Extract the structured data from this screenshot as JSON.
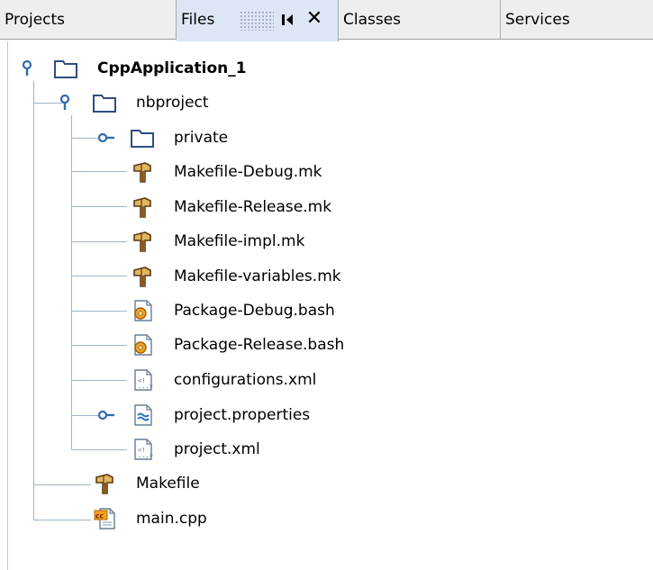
{
  "tabs": [
    {
      "label": "Projects"
    },
    {
      "label": "Files",
      "active": true
    },
    {
      "label": "Classes"
    },
    {
      "label": "Services"
    }
  ],
  "tab_icons": {
    "minimize": "minimize-icon",
    "close": "close-icon",
    "grip": "drag-grip-icon"
  },
  "tree": {
    "root": {
      "label": "CppApplication_1",
      "icon": "folder-icon",
      "expanded": true
    },
    "nbproject": {
      "label": "nbproject",
      "icon": "folder-icon",
      "expanded": true
    },
    "private": {
      "label": "private",
      "icon": "folder-icon",
      "expanded": false
    },
    "files": [
      {
        "label": "Makefile-Debug.mk",
        "icon": "makefile-icon"
      },
      {
        "label": "Makefile-Release.mk",
        "icon": "makefile-icon"
      },
      {
        "label": "Makefile-impl.mk",
        "icon": "makefile-icon"
      },
      {
        "label": "Makefile-variables.mk",
        "icon": "makefile-icon"
      },
      {
        "label": "Package-Debug.bash",
        "icon": "shell-script-icon"
      },
      {
        "label": "Package-Release.bash",
        "icon": "shell-script-icon"
      },
      {
        "label": "configurations.xml",
        "icon": "xml-file-icon"
      },
      {
        "label": "project.properties",
        "icon": "properties-file-icon",
        "expandable": true
      },
      {
        "label": "project.xml",
        "icon": "xml-file-icon"
      }
    ],
    "root_files": [
      {
        "label": "Makefile",
        "icon": "makefile-icon"
      },
      {
        "label": "main.cpp",
        "icon": "cpp-file-icon"
      }
    ]
  },
  "colors": {
    "tab_bg": "#eeeeee",
    "active_tab_bg": "#dde6f4",
    "guide_line": "#9fb4ca",
    "folder_blue": "#2e4d7e",
    "hammer_brown": "#8a5a24"
  }
}
